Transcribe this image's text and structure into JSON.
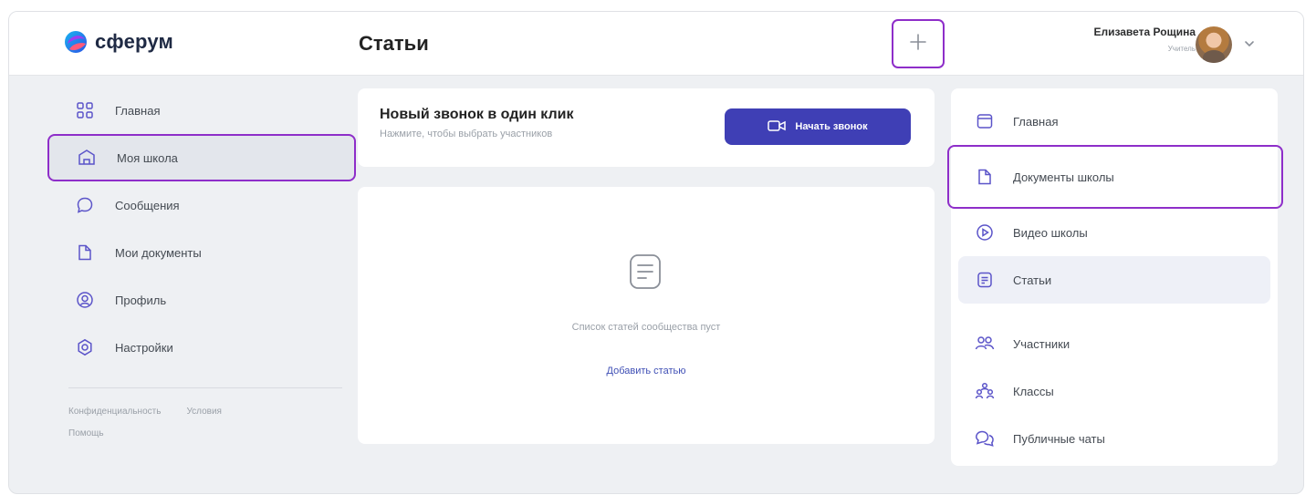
{
  "app": {
    "logo_text": "сферум",
    "page_title": "Статьи"
  },
  "header": {
    "add_icon": "plus-icon",
    "user": {
      "name": "Елизавета Рощина",
      "role": "Учитель"
    }
  },
  "sidebar": {
    "items": [
      {
        "label": "Главная",
        "icon": "grid-icon"
      },
      {
        "label": "Моя школа",
        "icon": "school-icon",
        "active": true
      },
      {
        "label": "Сообщения",
        "icon": "chat-icon"
      },
      {
        "label": "Мои документы",
        "icon": "document-icon"
      },
      {
        "label": "Профиль",
        "icon": "profile-icon"
      },
      {
        "label": "Настройки",
        "icon": "settings-icon"
      }
    ],
    "footer": {
      "privacy": "Конфиденциальность",
      "terms": "Условия",
      "help": "Помощь"
    }
  },
  "call_card": {
    "title": "Новый звонок в один клик",
    "subtitle": "Нажмите, чтобы выбрать участников",
    "button_label": "Начать звонок"
  },
  "articles": {
    "empty_text": "Список статей сообщества пуст",
    "add_link": "Добавить статью"
  },
  "right_menu": {
    "items": [
      {
        "label": "Главная",
        "icon": "window-icon"
      },
      {
        "label": "Документы школы",
        "icon": "document-icon",
        "highlighted": true
      },
      {
        "label": "Видео школы",
        "icon": "video-icon"
      },
      {
        "label": "Статьи",
        "icon": "article-icon",
        "selected": true
      },
      {
        "label": "Участники",
        "icon": "users-icon"
      },
      {
        "label": "Классы",
        "icon": "classes-icon"
      },
      {
        "label": "Публичные чаты",
        "icon": "chats-icon"
      }
    ]
  },
  "colors": {
    "accent_outline": "#8e2ec9",
    "primary_button": "#3f3fb5",
    "background": "#eef0f3",
    "icon_purple": "#5b54c9"
  }
}
